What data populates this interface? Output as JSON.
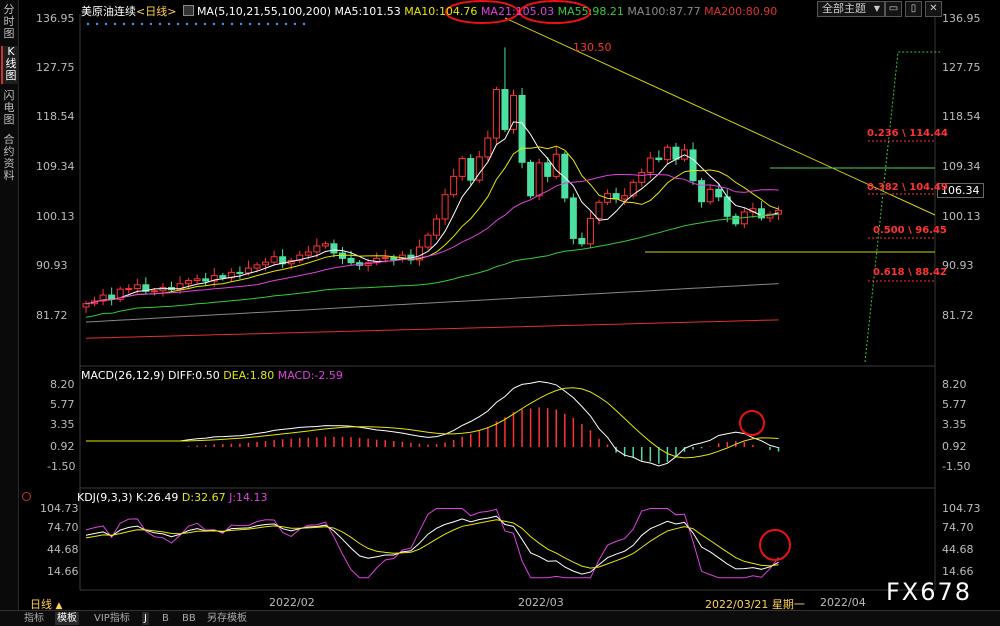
{
  "sidebar": {
    "tabs": [
      {
        "label": "分时图",
        "active": false
      },
      {
        "label": "K线图",
        "active": true
      },
      {
        "label": "闪电图",
        "active": false
      },
      {
        "label": "合约资料",
        "active": false
      }
    ]
  },
  "header": {
    "title": "美原油连续",
    "period": "<日线>",
    "ma_params": "MA(5,10,21,55,100,200)",
    "ma5": "MA5:101.53",
    "ma10": "MA10:104.76",
    "ma21": "MA21:105.03",
    "ma55": "MA55:98.21",
    "ma100": "MA100:87.77",
    "ma200": "MA200:80.90",
    "theme_dropdown": "全部主题",
    "dropdown_arrow": "▼",
    "window_buttons": [
      "▭",
      "▯",
      "✕"
    ]
  },
  "price_axis": {
    "ticks": [
      "136.95",
      "127.75",
      "118.54",
      "109.34",
      "100.13",
      "90.93",
      "81.72"
    ],
    "current_price": "106.34"
  },
  "annotations": {
    "high": "130.50",
    "fib_236": "0.236 \\ 114.44",
    "fib_382": "0.382 \\ 104.49",
    "fib_500": "0.500 \\ 96.45",
    "fib_618": "0.618 \\ 88.42"
  },
  "macd": {
    "title": "MACD(26,12,9)",
    "diff": "DIFF:0.50",
    "dea": "DEA:1.80",
    "macd": "MACD:-2.59",
    "ticks": [
      "8.20",
      "5.77",
      "3.35",
      "0.92",
      "-1.50"
    ]
  },
  "kdj": {
    "title": "KDJ(9,3,3)",
    "k": "K:26.49",
    "d": "D:32.67",
    "j": "J:14.13",
    "ticks": [
      "104.73",
      "74.70",
      "44.68",
      "14.66"
    ]
  },
  "time_axis": {
    "labels": [
      "2022/02",
      "2022/03",
      "2022/03/21 星期一",
      "2022/04"
    ]
  },
  "bottom_bar": {
    "period_label": "日线",
    "period_arrow": "▲",
    "tabs": [
      {
        "label": "指标",
        "active": false
      },
      {
        "label": "模板",
        "active": true
      },
      {
        "label": "VIP指标",
        "active": false
      },
      {
        "label": "J",
        "active": true
      },
      {
        "label": "B",
        "active": false
      },
      {
        "label": "BB",
        "active": false
      },
      {
        "label": "另存模板",
        "active": false
      }
    ]
  },
  "watermark": "FX678",
  "colors": {
    "up_candle": "#ff3333",
    "down_candle": "#4ce0a0",
    "ma5": "#ffffff",
    "ma10": "#e6e600",
    "ma21": "#e040e0",
    "ma55": "#33cc33",
    "ma100": "#888888",
    "ma200": "#e03030",
    "trendline": "#d4d400",
    "fib_text": "#ff3333",
    "highlight_circle": "#ee1111"
  }
}
